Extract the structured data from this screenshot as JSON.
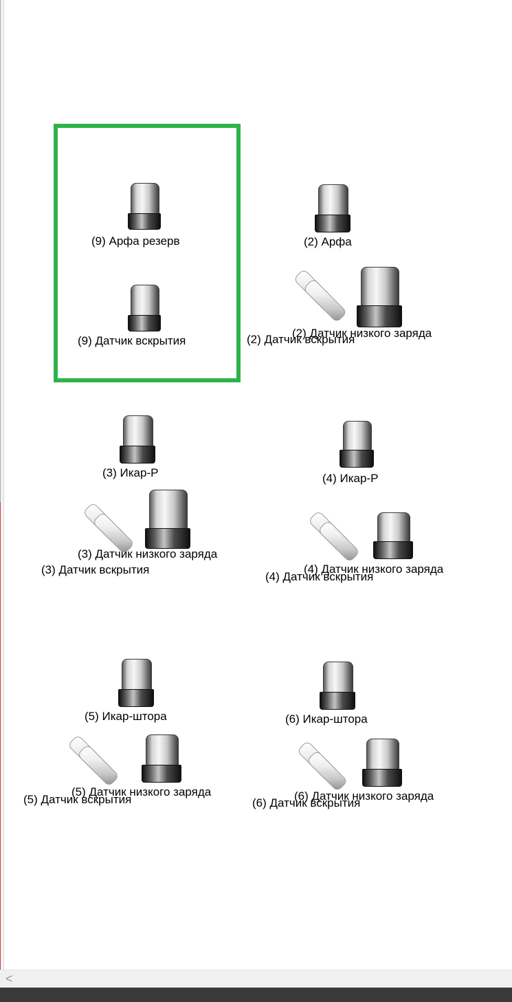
{
  "canvas": {
    "selection_color": "#2eb34b",
    "devices": [
      {
        "id": "arfa9",
        "label": "(9) Арфа резерв",
        "icon": "cylinder-detector-icon"
      },
      {
        "id": "tamper9",
        "label": "(9) Датчик вскрытия",
        "icon": "cylinder-detector-icon"
      },
      {
        "id": "arfa2",
        "label": "(2) Арфа",
        "icon": "cylinder-detector-icon"
      },
      {
        "id": "tamper2",
        "label": "(2) Датчик вскрытия",
        "icon": "magnetic-contact-icon"
      },
      {
        "id": "lowbat2",
        "label": "(2) Датчик низкого заряда",
        "icon": "cylinder-detector-icon"
      },
      {
        "id": "ikar3",
        "label": "(3) Икар-Р",
        "icon": "cylinder-detector-icon"
      },
      {
        "id": "lowbat3",
        "label": "(3) Датчик низкого заряда",
        "icon": "cylinder-detector-icon"
      },
      {
        "id": "tamper3",
        "label": "(3) Датчик вскрытия",
        "icon": "magnetic-contact-icon"
      },
      {
        "id": "ikar4",
        "label": "(4)  Икар-Р",
        "icon": "cylinder-detector-icon"
      },
      {
        "id": "lowbat4",
        "label": "(4) Датчик низкого заряда",
        "icon": "cylinder-detector-icon"
      },
      {
        "id": "tamper4",
        "label": "(4) Датчик вскрытия",
        "icon": "magnetic-contact-icon"
      },
      {
        "id": "ikarshtora5",
        "label": "(5) Икар-штора",
        "icon": "cylinder-detector-icon"
      },
      {
        "id": "lowbat5",
        "label": "(5) Датчик низкого заряда",
        "icon": "cylinder-detector-icon"
      },
      {
        "id": "tamper5",
        "label": "(5) Датчик вскрытия",
        "icon": "magnetic-contact-icon"
      },
      {
        "id": "ikarshtora6",
        "label": "(6) Икар-штора",
        "icon": "cylinder-detector-icon"
      },
      {
        "id": "lowbat6",
        "label": "(6) Датчик низкого заряда",
        "icon": "cylinder-detector-icon"
      },
      {
        "id": "tamper6",
        "label": "(6) Датчик вскрытия",
        "icon": "magnetic-contact-icon"
      }
    ]
  },
  "scrollbar": {
    "left_arrow": "<"
  }
}
